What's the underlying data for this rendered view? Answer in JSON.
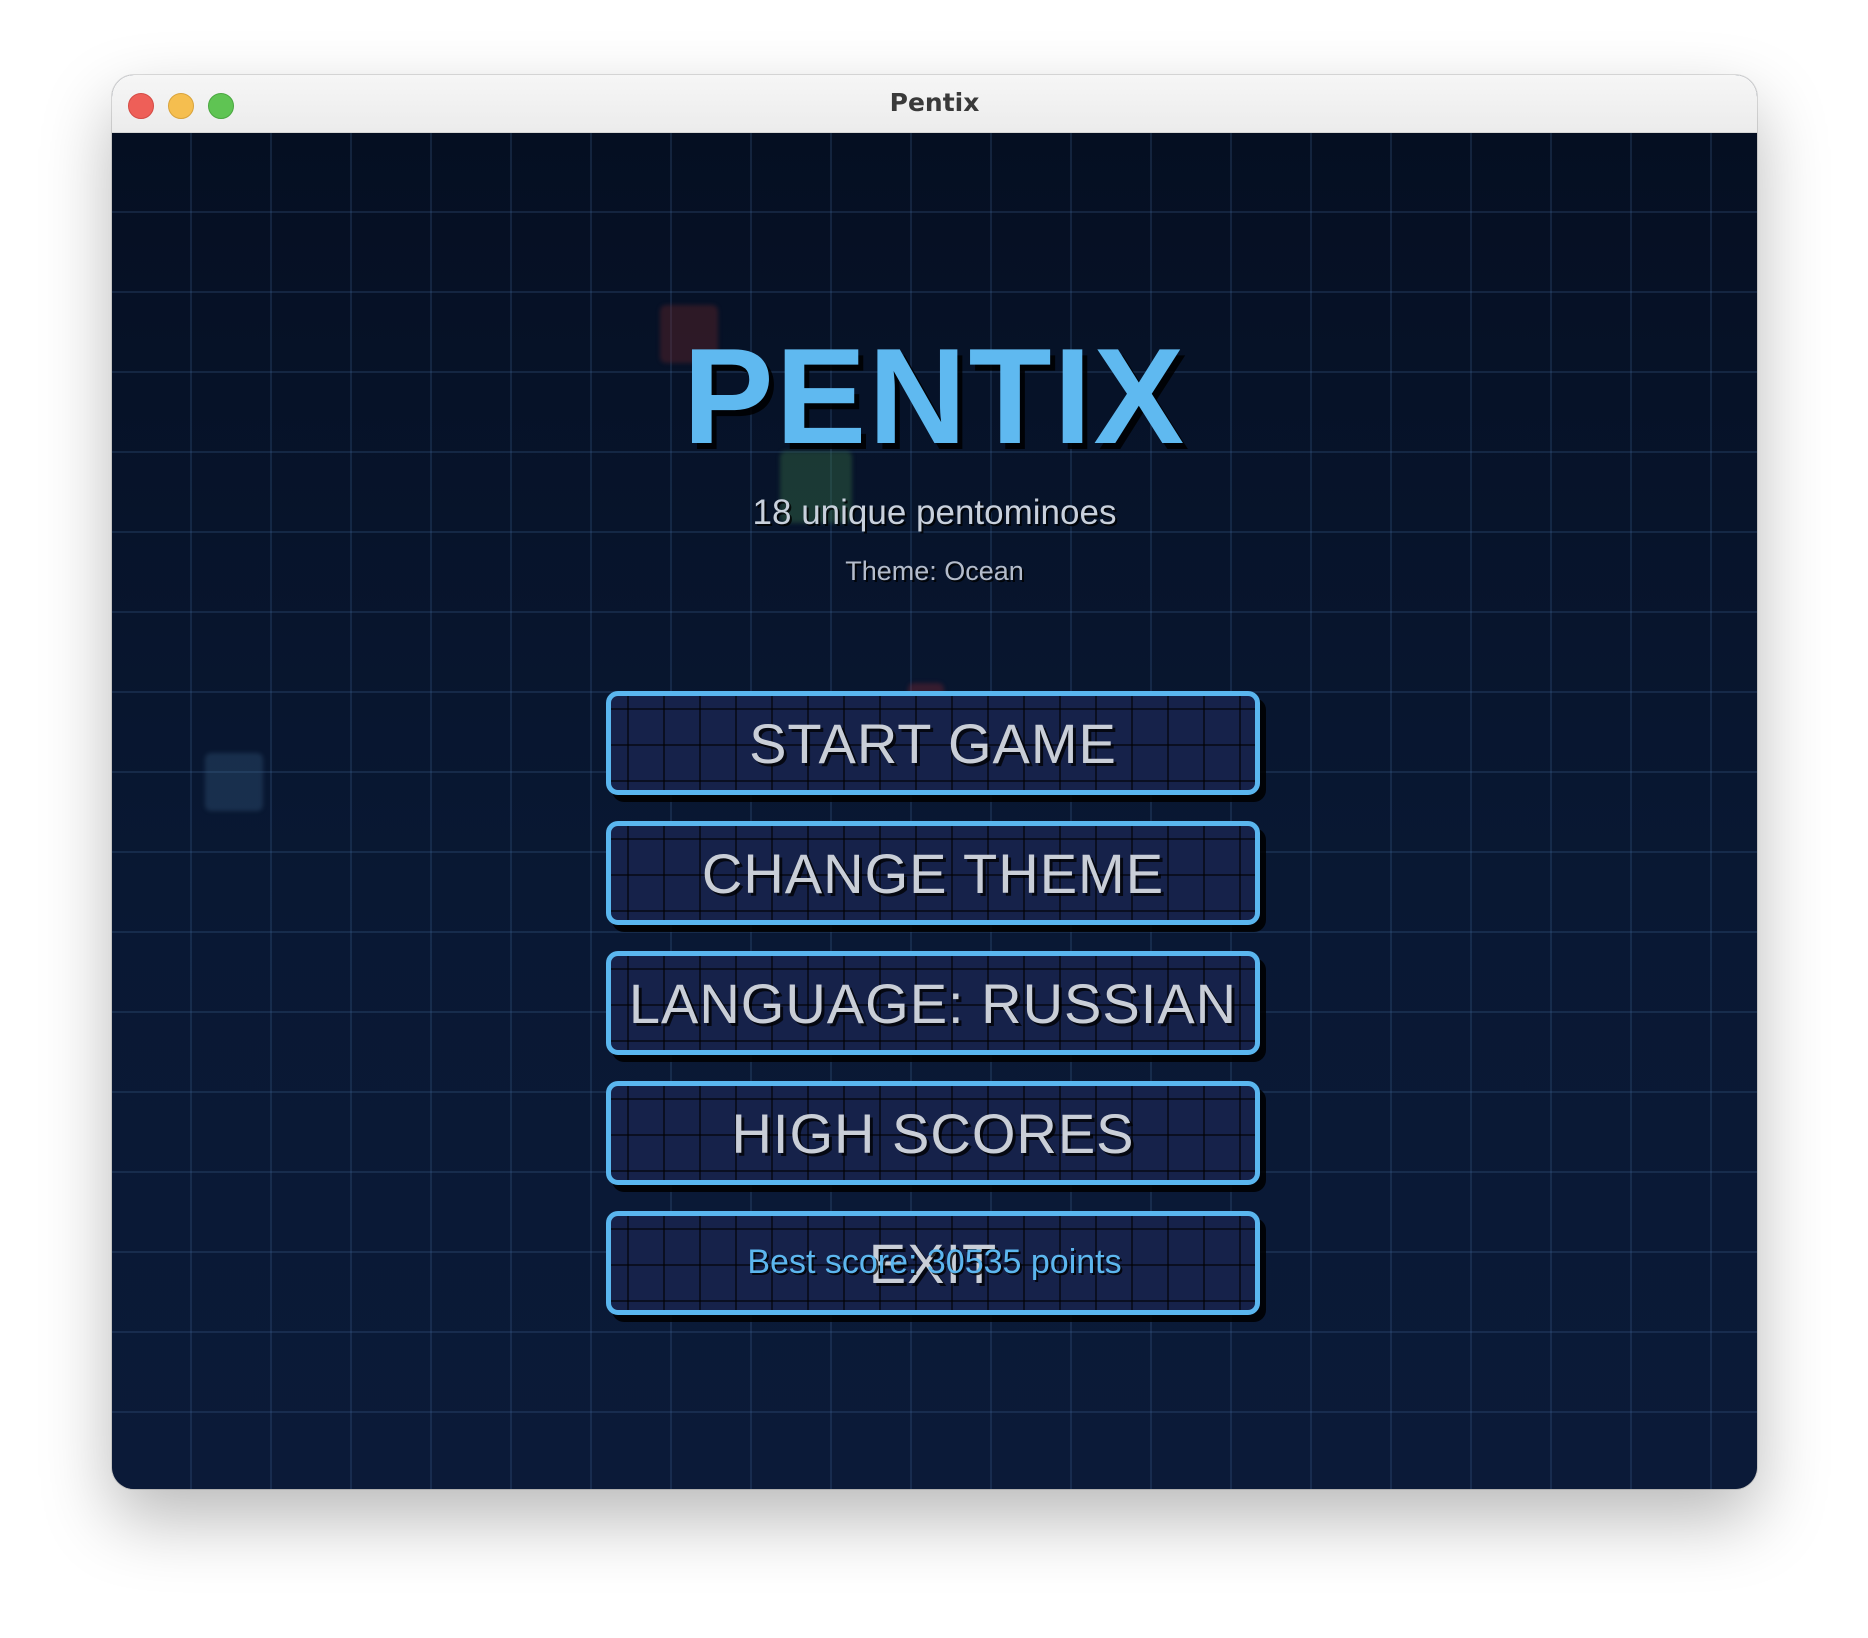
{
  "window": {
    "title": "Pentix"
  },
  "game": {
    "logo": "PENTIX",
    "subtitle": "18 unique pentominoes",
    "theme_label": "Theme: Ocean",
    "menu": {
      "start_game": "START GAME",
      "change_theme": "CHANGE THEME",
      "language": "LANGUAGE: RUSSIAN",
      "high_scores": "HIGH SCORES",
      "exit": "EXIT"
    },
    "best_score": "Best score: 30535 points"
  },
  "colors": {
    "accent": "#5fb9f0",
    "background": "#0a1630",
    "button_fill": "#16224a",
    "button_text": "#c9ced7"
  },
  "icons": {
    "close": "close-icon",
    "minimize": "minimize-icon",
    "maximize": "maximize-icon"
  }
}
